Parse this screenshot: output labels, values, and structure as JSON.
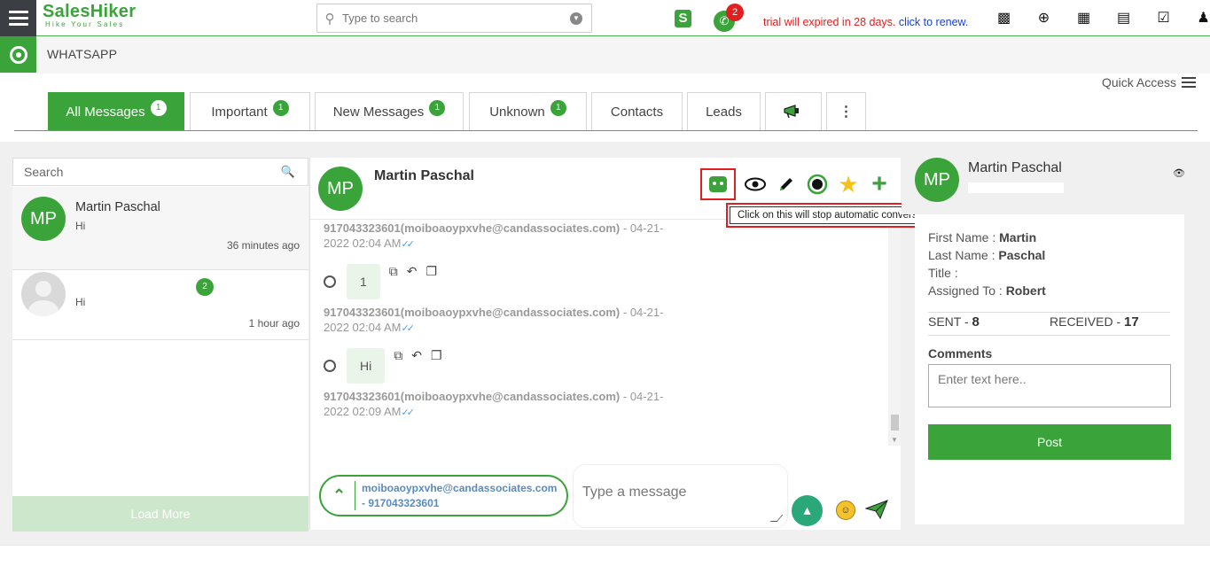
{
  "brand": {
    "logo_text": "SalesHiker",
    "tagline": "Hike Your Sales"
  },
  "top_search": {
    "placeholder": "Type to search"
  },
  "notifications": {
    "whatsapp_count": "2"
  },
  "trial": {
    "notice": "trial will expired in 28 days.",
    "renew_link": "click to renew."
  },
  "top_icons": [
    "money-icon",
    "plus-circle-icon",
    "calendar-icon",
    "bar-chart-icon",
    "checkbox-icon",
    "user-icon"
  ],
  "page": {
    "title": "WHATSAPP"
  },
  "quick_access": {
    "label": "Quick Access"
  },
  "tabs": [
    {
      "label": "All Messages",
      "badge": "1",
      "active": true
    },
    {
      "label": "Important",
      "badge": "1"
    },
    {
      "label": "New Messages",
      "badge": "1"
    },
    {
      "label": "Unknown",
      "badge": "1"
    },
    {
      "label": "Contacts"
    },
    {
      "label": "Leads"
    }
  ],
  "list": {
    "search_placeholder": "Search",
    "conversations": [
      {
        "initials": "MP",
        "name": "Martin Paschal",
        "message": "Hi",
        "time": "36 minutes ago"
      },
      {
        "initials": "",
        "name": "",
        "message": "Hi",
        "time": "1 hour ago",
        "badge": "2"
      }
    ],
    "load_more": "Load More"
  },
  "chat": {
    "contact_initials": "MP",
    "contact_name": "Martin Paschal",
    "tooltip": "Click on this will stop automatic conversation from Bot",
    "messages": [
      {
        "meta": "917043323601(moiboaoypxvhe@candassociates.com)",
        "date": "- 04-21-",
        "time": "2022 02:04 AM"
      },
      {
        "body": "1",
        "meta": "917043323601(moiboaoypxvhe@candassociates.com)",
        "date": "- 04-21-",
        "time": "2022 02:04 AM"
      },
      {
        "body": "Hi",
        "meta": "917043323601(moiboaoypxvhe@candassociates.com)",
        "date": "- 04-21-",
        "time": "2022 02:09 AM"
      }
    ],
    "sender_email": "moiboaoypxvhe@candassociates.com",
    "sender_phone": "- 917043323601",
    "input_placeholder": "Type a message"
  },
  "info": {
    "initials": "MP",
    "name": "Martin Paschal",
    "first_name_label": "First Name :",
    "first_name": "Martin",
    "last_name_label": "Last Name :",
    "last_name": "Paschal",
    "title_label": "Title :",
    "title": "",
    "assigned_label": "Assigned To :",
    "assigned_to": "Robert",
    "sent_label": "SENT -",
    "sent": "8",
    "received_label": "RECEIVED -",
    "received": "17",
    "comments_label": "Comments",
    "comments_placeholder": "Enter text here..",
    "post_label": "Post"
  },
  "colors": {
    "brand_green": "#3aa43a",
    "alert_red": "#e02020",
    "link_blue": "#1a3fd6"
  }
}
